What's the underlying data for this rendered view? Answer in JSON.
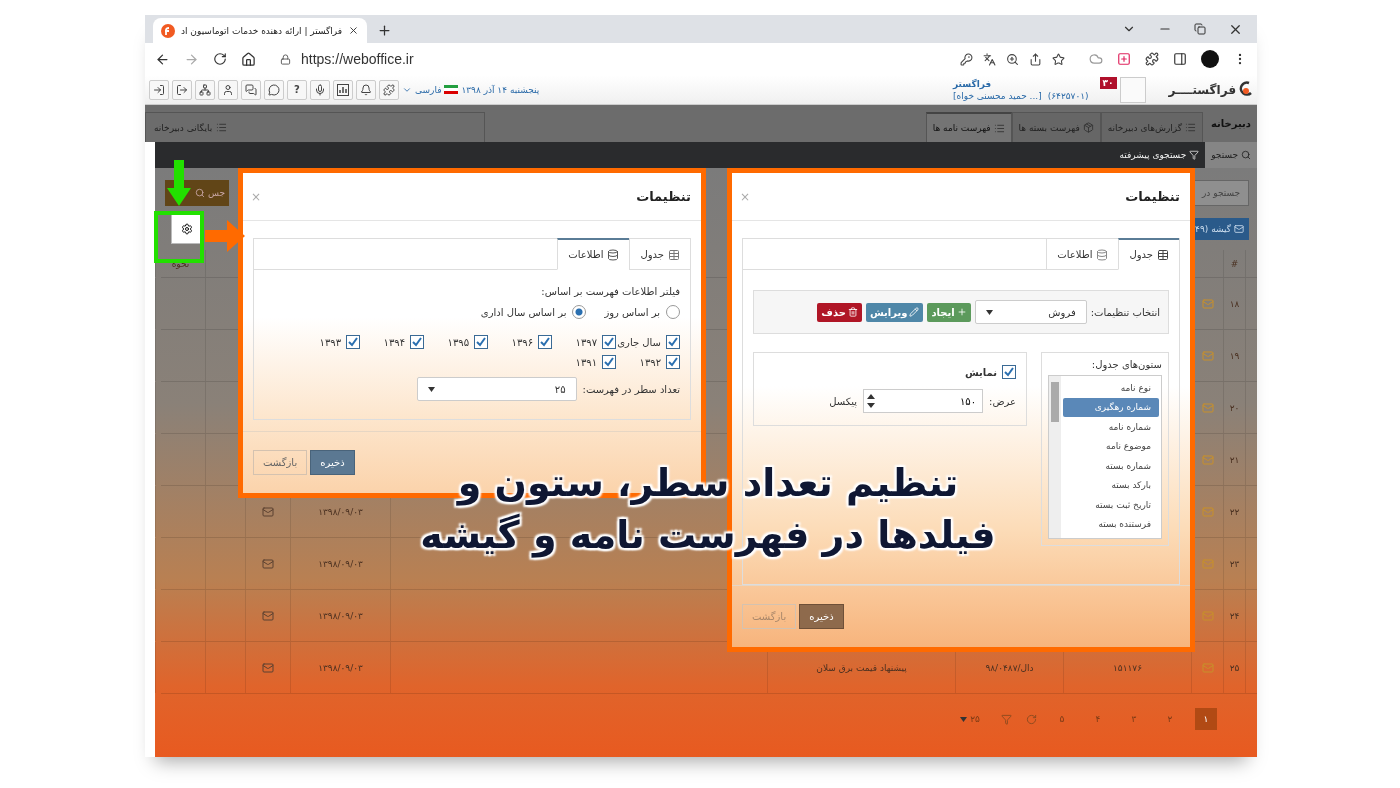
{
  "browser": {
    "tab_title": "فراگستر | ارائه دهنده خدمات اتوماسیون اد",
    "url": "https://weboffice.ir"
  },
  "app_header": {
    "help": "?",
    "language": "فارسی",
    "date": "پنجشنبه ۱۴ آذر ۱۳۹۸",
    "logo": "فراگستــــر",
    "badge": "۳۰",
    "company": "فراگستر",
    "code": "(۶۴۲۵۷۰۱)",
    "user": "[حمید محسنی خواه ...]"
  },
  "module": {
    "title": "دبیرخانه",
    "tabs": [
      {
        "label": "گزارش‌های دبیرخانه",
        "selected": false
      },
      {
        "label": "فهرست بسته ها",
        "selected": false
      },
      {
        "label": "فهرست نامه ها",
        "selected": true
      }
    ],
    "archive": "بایگانی دبیرخانه"
  },
  "search_tabs": [
    {
      "label": "جستجو",
      "selected": true
    },
    {
      "label": "جستجوی پیشرفته",
      "selected": false
    }
  ],
  "search_panel": {
    "search_button": "جس",
    "search_in": "جستجو در",
    "kiosk_tab": "گیشه (۴۹"
  },
  "table": {
    "sort_header": "نحوه",
    "number_header": "#",
    "rows": [
      {
        "number": "۱۸"
      },
      {
        "number": "۱۹"
      },
      {
        "number": "۲۰"
      },
      {
        "number": "۲۱"
      },
      {
        "number": "۲۲",
        "date": "۱۳۹۸/۰۹/۰۳"
      },
      {
        "number": "۲۳",
        "date": "۱۳۹۸/۰۹/۰۳"
      },
      {
        "number": "۲۴",
        "date": "۱۳۹۸/۰۹/۰۳"
      },
      {
        "number": "۲۵",
        "tracking": "۱۵۱۱۷۶",
        "letter_number": "دال/۹۸/۰۴۸۷",
        "subject": "پیشنهاد قیمت برق سلان",
        "date": "۱۳۹۸/۰۹/۰۳"
      }
    ]
  },
  "pagination": {
    "pages": [
      {
        "label": "۱",
        "selected": true
      },
      {
        "label": "۲",
        "selected": false
      },
      {
        "label": "۳",
        "selected": false
      },
      {
        "label": "۴",
        "selected": false
      },
      {
        "label": "۵",
        "selected": false
      }
    ],
    "page_size": "۲۵"
  },
  "dialogs": [
    {
      "kind": "table",
      "title": "تنظیمات",
      "close": "×",
      "tabs": [
        {
          "label": "جدول",
          "selected": true
        },
        {
          "label": "اطلاعات",
          "selected": false
        }
      ],
      "preset_label": "انتخاب تنظیمات:",
      "preset_value": "فروش",
      "actions": [
        {
          "label": "ایجاد",
          "kind": "create"
        },
        {
          "label": "ویرایش",
          "kind": "edit"
        },
        {
          "label": "حذف",
          "kind": "delete"
        }
      ],
      "columns_label": "ستون‌های جدول:",
      "columns": [
        {
          "label": "نوع نامه",
          "selected": false
        },
        {
          "label": "شماره رهگیری",
          "selected": true
        },
        {
          "label": "شماره نامه",
          "selected": false
        },
        {
          "label": "موضوع نامه",
          "selected": false
        },
        {
          "label": "شماره بسته",
          "selected": false
        },
        {
          "label": "بارکد بسته",
          "selected": false
        },
        {
          "label": "تاریخ ثبت بسته",
          "selected": false
        },
        {
          "label": "فرستنده بسته",
          "selected": false
        }
      ],
      "show": {
        "label": "نمایش",
        "checked": true
      },
      "width_label": "عرض:",
      "width_value": "۱۵۰",
      "unit": "پیکسل",
      "buttons": [
        "ذخیره",
        "بازگشت"
      ]
    },
    {
      "kind": "info",
      "title": "تنظیمات",
      "close": "×",
      "tabs": [
        {
          "label": "جدول",
          "selected": false
        },
        {
          "label": "اطلاعات",
          "selected": true
        }
      ],
      "filter_label": "فیلتر اطلاعات فهرست بر اساس:",
      "radios": [
        {
          "label": "بر اساس روز",
          "selected": false
        },
        {
          "label": "بر اساس سال اداری",
          "selected": true
        }
      ],
      "years": [
        {
          "label": "سال جاری",
          "checked": true
        },
        {
          "label": "۱۳۹۷",
          "checked": true
        },
        {
          "label": "۱۳۹۶",
          "checked": true
        },
        {
          "label": "۱۳۹۵",
          "checked": true
        },
        {
          "label": "۱۳۹۴",
          "checked": true
        },
        {
          "label": "۱۳۹۳",
          "checked": true
        },
        {
          "label": "۱۳۹۲",
          "checked": true
        },
        {
          "label": "۱۳۹۱",
          "checked": true
        }
      ],
      "rows_label": "تعداد سطر در فهرست:",
      "rows_value": "۲۵",
      "buttons": [
        "ذخیره",
        "بازگشت"
      ]
    }
  ],
  "headline": [
    "تنظیم تعداد سطر، ستون و",
    "فیلدها در فهرست نامه و گیشه"
  ]
}
